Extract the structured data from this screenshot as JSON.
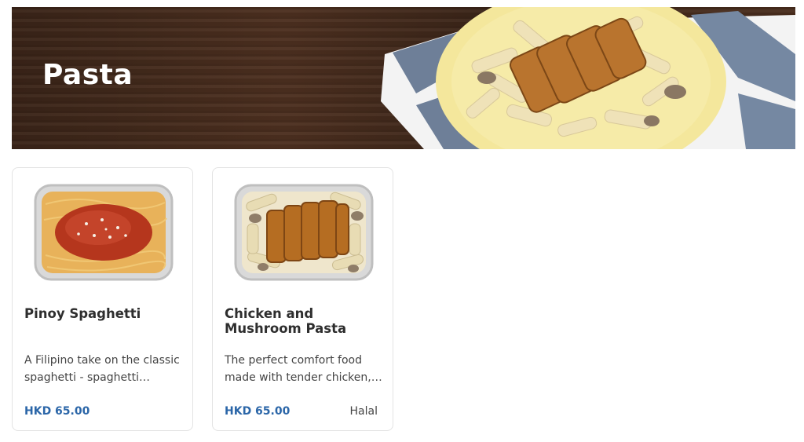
{
  "banner": {
    "title": "Pasta",
    "image_icon": "chicken-mushroom-pasta-plate-photo"
  },
  "menu_items": [
    {
      "name": "Pinoy Spaghetti",
      "description": "A Filipino take on the classic spaghetti - spaghetti noodles in a sweet-style tomato sauce",
      "price": "HKD 65.00",
      "badge": "",
      "image_icon": "spaghetti-tray-photo"
    },
    {
      "name": "Chicken and Mushroom Pasta",
      "description": "The perfect comfort food made with tender chicken, mushrooms and penne in a creamy sauce",
      "price": "HKD 65.00",
      "badge": "Halal",
      "image_icon": "chicken-mushroom-pasta-tray-photo"
    }
  ],
  "colors": {
    "price": "#2b66a8",
    "banner_wood": "#4a2e1e",
    "card_border": "#e3e3e3"
  }
}
